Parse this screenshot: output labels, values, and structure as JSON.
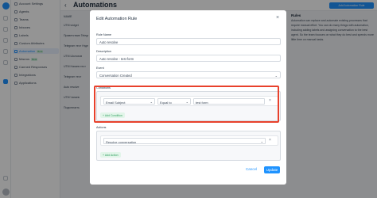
{
  "sidebar": {
    "items": [
      {
        "label": "Account Settings",
        "active": false
      },
      {
        "label": "Agents",
        "active": false
      },
      {
        "label": "Teams",
        "active": false
      },
      {
        "label": "Inboxes",
        "active": false
      },
      {
        "label": "Labels",
        "active": false
      },
      {
        "label": "Custom Attributes",
        "active": false
      },
      {
        "label": "Automation",
        "active": true,
        "badge": "Beta"
      },
      {
        "label": "Macros",
        "active": false,
        "badge": "Beta"
      },
      {
        "label": "Canned Responses",
        "active": false
      },
      {
        "label": "Integrations",
        "active": false
      },
      {
        "label": "Applications",
        "active": false
      }
    ]
  },
  "header": {
    "title": "Automations",
    "add_button": "Add Automation Rule"
  },
  "table": {
    "header": "NAME",
    "rows": [
      "UTM widget",
      "Приветствие Telegr",
      "Telegram тест Нгде",
      "UTM Шолохов",
      "UTM Нагаев тест",
      "Telegram тест",
      "Auto resolve",
      "UTM Чагаев",
      "Подключить"
    ]
  },
  "right_panel": {
    "title": "Rules",
    "text": "Automation can replace and automate existing processes that require manual effort. You can do many things with automation, including adding labels and assigning conversation to the best agent. So the team focuses on what they do best and spends more little time on manual tasks."
  },
  "modal": {
    "title": "Edit Automation Rule",
    "name_label": "Rule Name",
    "name_value": "Auto resolve",
    "description_label": "Description",
    "description_value": "Auto resolve - test form",
    "event_label": "Event",
    "event_value": "Conversation Created",
    "conditions_label": "Conditions",
    "condition": {
      "attribute": "Email Subject",
      "operator": "Equal to",
      "value": "test form"
    },
    "add_condition": "+ Add Condition",
    "actions_label": "Actions",
    "action_value": "Resolve conversation",
    "add_action": "+ Add Action",
    "cancel": "Cancel",
    "update": "Update",
    "close_glyph": "×",
    "caret_glyph": "⌄",
    "remove_glyph": "×"
  },
  "colors": {
    "accent": "#1f93ff",
    "highlight": "#e8412c",
    "success_bg": "#e2f5e9",
    "success_text": "#2e9e5e"
  }
}
